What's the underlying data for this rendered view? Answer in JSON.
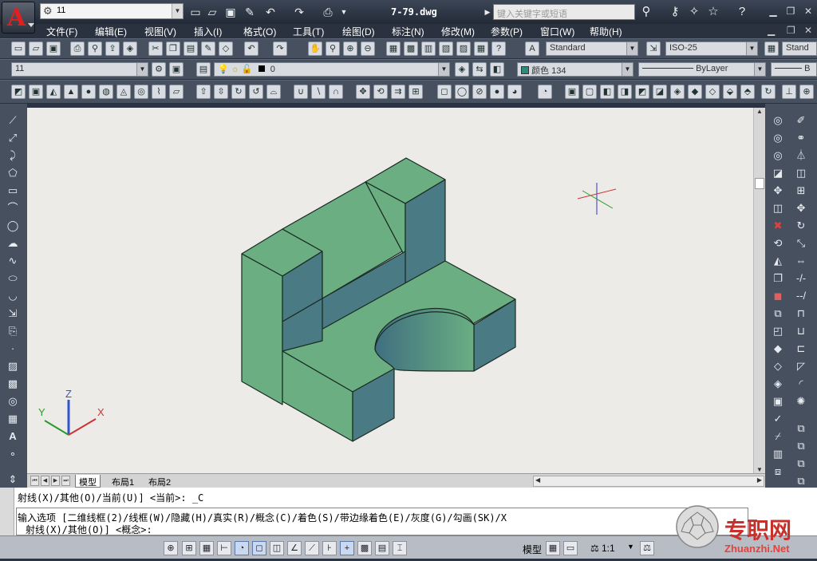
{
  "titlebar": {
    "workspace": "11",
    "doc_title": "7-79.dwg",
    "search_placeholder": "键入关键字或短语"
  },
  "menu": [
    "文件(F)",
    "编辑(E)",
    "视图(V)",
    "插入(I)",
    "格式(O)",
    "工具(T)",
    "绘图(D)",
    "标注(N)",
    "修改(M)",
    "参数(P)",
    "窗口(W)",
    "帮助(H)"
  ],
  "styles": {
    "text_style": "Standard",
    "dim_style": "ISO-25",
    "table_style": "Stand"
  },
  "layers": {
    "layer_combo": "11",
    "current_layer": "0",
    "color": "颜色 134",
    "linetype": "ByLayer",
    "lineweight": "B"
  },
  "tabs": {
    "model": "模型",
    "layout1": "布局1",
    "layout2": "布局2"
  },
  "command": {
    "line1": "射线(X)/其他(O)/当前(U)] <当前>: _C",
    "line2": "输入选项 [二维线框(2)/线框(W)/隐藏(H)/真实(R)/概念(C)/着色(S)/带边缘着色(E)/灰度(G)/勾画(SK)/X",
    "line3": "射线(X)/其他(O)] <概念>:"
  },
  "status": {
    "model_label": "模型",
    "scale": "1:1"
  },
  "watermark": {
    "cn": "专职网",
    "url": "Zhuanzhi.Net"
  },
  "ucs": {
    "x": "X",
    "y": "Y",
    "z": "Z"
  },
  "colors": {
    "solid_front": "#6aae82",
    "solid_side": "#4a7a84",
    "canvas": "#ecebe8"
  }
}
